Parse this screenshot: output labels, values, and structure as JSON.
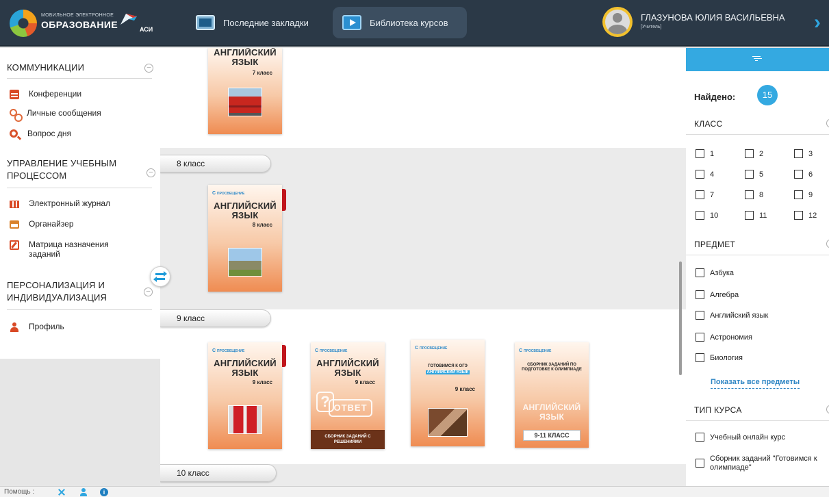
{
  "header": {
    "logo_small": "Мобильное электронное",
    "logo_big": "ОБРАЗОВАНИЕ",
    "logo_suffix": "АСИ",
    "tabs": [
      {
        "label": "Последние закладки",
        "active": false
      },
      {
        "label": "Библиотека курсов",
        "active": true
      }
    ],
    "user_name": "ГЛАЗУНОВА ЮЛИЯ ВАСИЛЬЕВНА",
    "user_role": "[Учитель]"
  },
  "sidebar": {
    "sections": [
      {
        "title": "КОММУНИКАЦИИ",
        "items": [
          "Конференции",
          "Личные сообщения",
          "Вопрос дня"
        ]
      },
      {
        "title": "УПРАВЛЕНИЕ УЧЕБНЫМ ПРОЦЕССОМ",
        "items": [
          "Электронный журнал",
          "Органайзер",
          "Матрица назначения заданий"
        ]
      },
      {
        "title": "ПЕРСОНАЛИЗАЦИЯ И ИНДИВИДУАЛИЗАЦИЯ",
        "items": [
          "Профиль"
        ]
      }
    ]
  },
  "library": {
    "grades": [
      "8 класс",
      "9 класс",
      "10 класс"
    ],
    "books": [
      {
        "title": "АНГЛИЙСКИЙ ЯЗЫК",
        "grade": "7 класс",
        "publisher": ""
      },
      {
        "title": "АНГЛИЙСКИЙ ЯЗЫК",
        "grade": "8 класс",
        "publisher": "ПРОСВЕЩЕНИЕ"
      },
      {
        "title": "АНГЛИЙСКИЙ ЯЗЫК",
        "grade": "9 класс",
        "publisher": "ПРОСВЕЩЕНИЕ"
      },
      {
        "title": "АНГЛИЙСКИЙ ЯЗЫК",
        "grade": "9 класс",
        "publisher": "ПРОСВЕЩЕНИЕ",
        "stamp": "ОТВЕТ",
        "band": "СБОРНИК ЗАДАНИЙ С РЕШЕНИЯМИ"
      },
      {
        "title": "ГОТОВИМСЯ К ОГЭ",
        "subtitle": "АНГЛИЙСКИЙ ЯЗЫК",
        "grade": "9 класс",
        "publisher": "ПРОСВЕЩЕНИЕ"
      },
      {
        "title": "СБОРНИК ЗАДАНИЙ ПО ПОДГОТОВКЕ К ОЛИМПИАДЕ",
        "subtitle": "АНГЛИЙСКИЙ ЯЗЫК",
        "grade": "9-11 КЛАСС",
        "publisher": "ПРОСВЕЩЕНИЕ"
      }
    ]
  },
  "filter": {
    "found_label": "Найдено:",
    "found_count": "15",
    "class_heading": "КЛАСС",
    "classes": [
      "1",
      "2",
      "3",
      "4",
      "5",
      "6",
      "7",
      "8",
      "9",
      "10",
      "11",
      "12"
    ],
    "subject_heading": "ПРЕДМЕТ",
    "subjects": [
      "Азбука",
      "Алгебра",
      "Английский язык",
      "Астрономия",
      "Биология"
    ],
    "show_all": "Показать все предметы",
    "course_type_heading": "ТИП КУРСА",
    "course_types": [
      "Учебный онлайн курс",
      "Сборник заданий \"Готовимся к олимпиаде\""
    ]
  },
  "statusbar": {
    "help_label": "Помощь :",
    "info_glyph": "i"
  },
  "colors": {
    "topbar": "#2b3947",
    "accent_blue": "#34a9e1",
    "book_orange": "#ef8c52",
    "ribbon_red": "#c0151b"
  },
  "icons": [
    "conference-icon",
    "messages-icon",
    "question-icon",
    "journal-icon",
    "organizer-icon",
    "matrix-icon",
    "profile-icon",
    "filter-funnel-icon",
    "swap-arrows-icon",
    "tools-icon",
    "user-icon",
    "info-icon"
  ]
}
